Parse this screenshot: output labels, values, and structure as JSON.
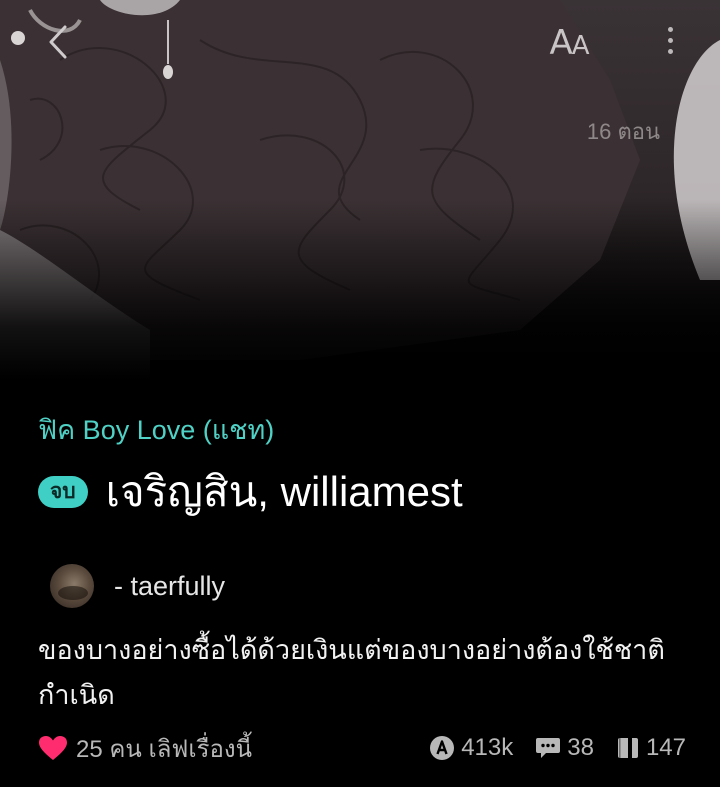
{
  "header": {
    "font_button_label_big": "A",
    "font_button_label_small": "A",
    "episodes": "16 ตอน"
  },
  "story": {
    "category": "ฟิค Boy Love (แชท)",
    "status_badge": "จบ",
    "title": "เจริญสิน, williamest",
    "author": "- taerfully",
    "description": "ของบางอย่างซื้อได้ด้วยเงินแต่ของบางอย่างต้องใช้ชาติกำเนิด"
  },
  "stats": {
    "likes": "25 คน เลิฟเรื่องนี้",
    "views": "413k",
    "comments": "38",
    "chapters": "147"
  },
  "icons": {
    "back": "chevron-left-icon",
    "font": "font-size-icon",
    "more": "more-vertical-icon",
    "heart": "heart-icon",
    "views": "views-icon",
    "comments": "comment-icon",
    "chapters": "book-icon"
  },
  "colors": {
    "accent": "#4fd1c5",
    "badge": "#3fcfc4",
    "heart": "#ff2d6f",
    "background": "#000000"
  }
}
